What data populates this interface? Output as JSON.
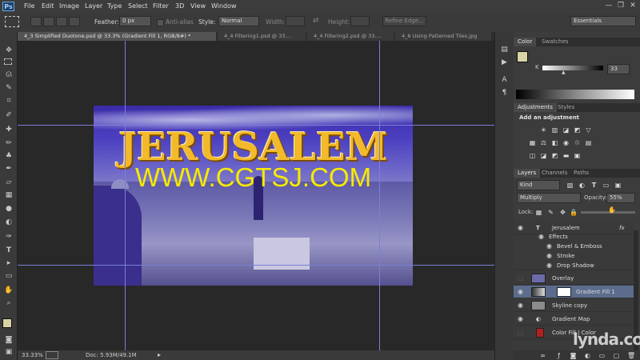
{
  "app": {
    "logo": "Ps"
  },
  "menu": [
    "File",
    "Edit",
    "Image",
    "Layer",
    "Type",
    "Select",
    "Filter",
    "3D",
    "View",
    "Window"
  ],
  "window_controls": {
    "minimize": "—",
    "restore": "❐",
    "close": "✕"
  },
  "options": {
    "feather_label": "Feather:",
    "feather_value": "0 px",
    "antialias_label": "Anti-alias",
    "style_label": "Style:",
    "style_value": "Normal",
    "width_label": "Width:",
    "height_label": "Height:",
    "refine_label": "Refine Edge...",
    "workspace": "Essentials"
  },
  "tabs": [
    {
      "label": "4_3 Simplified Duotone.psd @ 33.3% (Gradient Fill 1, RGB/8#) *"
    },
    {
      "label": "4_4 Filtering1.psd @ 33...."
    },
    {
      "label": "4_4 Filtering2.psd @ 33...."
    },
    {
      "label": "4_6 Using Patterned Tiles.jpg"
    }
  ],
  "artwork": {
    "title": "JERUSALEM",
    "watermark": "WWW.CGTSJ.COM"
  },
  "status": {
    "zoom": "33.33%",
    "doc": "Doc: 5.93M/49.1M"
  },
  "color_panel": {
    "tabs": [
      "Color",
      "Swatches"
    ],
    "channel": "K",
    "value": "33",
    "fg_color": "#d9d3a6",
    "bg_color": "#ffffff"
  },
  "adjustments_panel": {
    "tabs": [
      "Adjustments",
      "Styles"
    ],
    "heading": "Add an adjustment"
  },
  "layers_panel": {
    "tabs": [
      "Layers",
      "Channels",
      "Paths"
    ],
    "kind": "Kind",
    "blend": "Multiply",
    "opacity_label": "Opacity:",
    "opacity_value": "55%",
    "lock_label": "Lock:",
    "layers": [
      {
        "name": "Jerusalem",
        "fx": "fx"
      },
      {
        "name": "Effects"
      },
      {
        "name": "Bevel & Emboss"
      },
      {
        "name": "Stroke"
      },
      {
        "name": "Drop Shadow"
      },
      {
        "name": "Overlay"
      },
      {
        "name": "Gradient Fill 1"
      },
      {
        "name": "Skyline copy"
      },
      {
        "name": "Gradient Map"
      },
      {
        "name": "Color Fill | Color"
      }
    ]
  },
  "brand": "lynda.com",
  "colors": {
    "accent": "#5b6c8d",
    "title_gold": "#f2b92a",
    "watermark_yellow": "#f6ea00",
    "art_blue": "#4b3fc0"
  }
}
